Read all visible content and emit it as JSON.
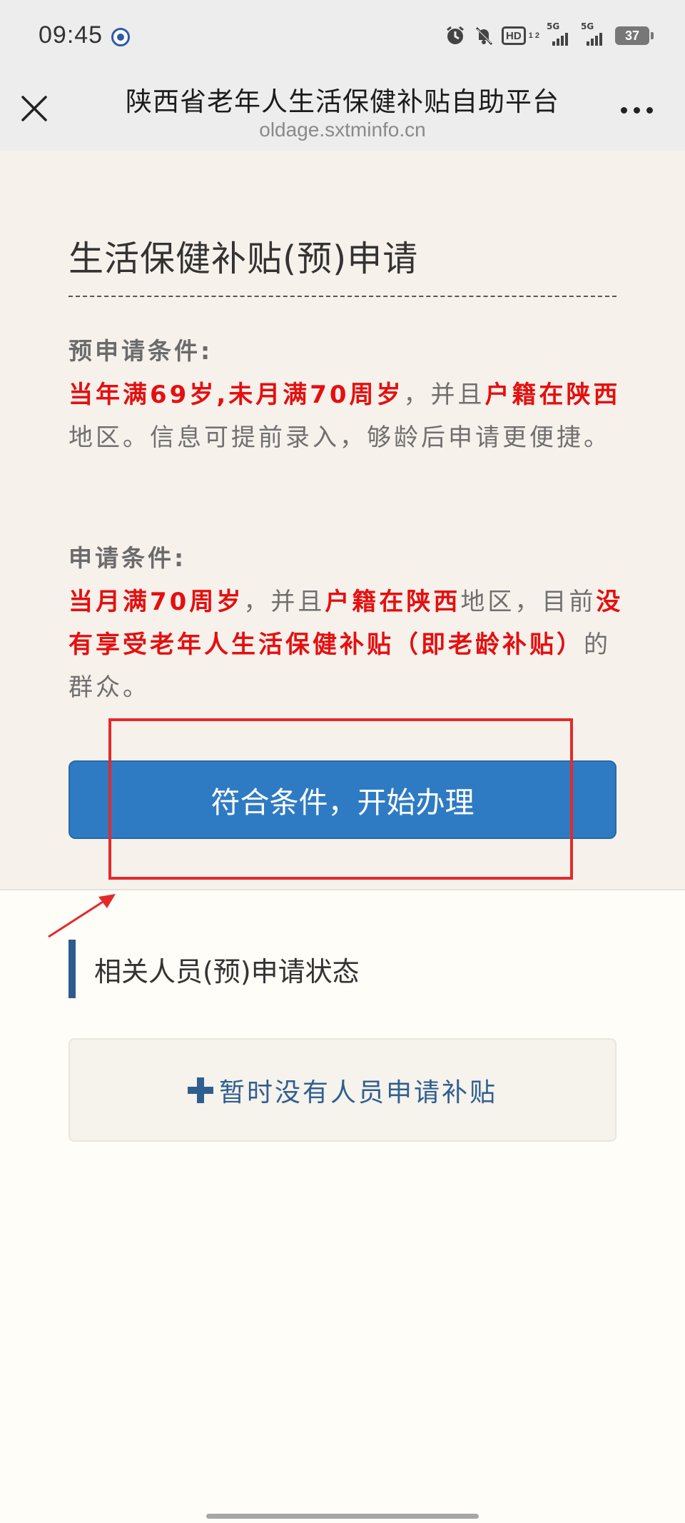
{
  "status_bar": {
    "time": "09:45",
    "hd_label": "HD",
    "hd_sub": "1 2",
    "signal1_label": "5G",
    "signal2_label": "5G",
    "battery": "37"
  },
  "title_bar": {
    "title": "陕西省老年人生活保健补贴自助平台",
    "url": "oldage.sxtminfo.cn"
  },
  "main": {
    "heading": "生活保健补贴(预)申请",
    "pre_conditions": {
      "label": "预申请条件:",
      "red1": "当年满69岁,未月满70周岁",
      "text1": "，并且",
      "red2": "户籍在陕西",
      "text2": "地区。信息可提前录入，够龄后申请更便捷。"
    },
    "conditions": {
      "label": "申请条件:",
      "red1": "当月满70周岁",
      "text1": "，并且",
      "red2": "户籍在陕西",
      "text2": "地区，目前",
      "red3": "没有享受老年人生活保健补贴（即老龄补贴）",
      "text3": "的群众。"
    },
    "start_button": "符合条件，开始办理"
  },
  "status_section": {
    "heading": "相关人员(预)申请状态",
    "empty_message": "暂时没有人员申请补贴"
  },
  "colors": {
    "button": "#2f7bc3",
    "highlight_red": "#e50f0f",
    "annotation_red": "#e32a2a",
    "accent_bar": "#2e5b8f"
  }
}
